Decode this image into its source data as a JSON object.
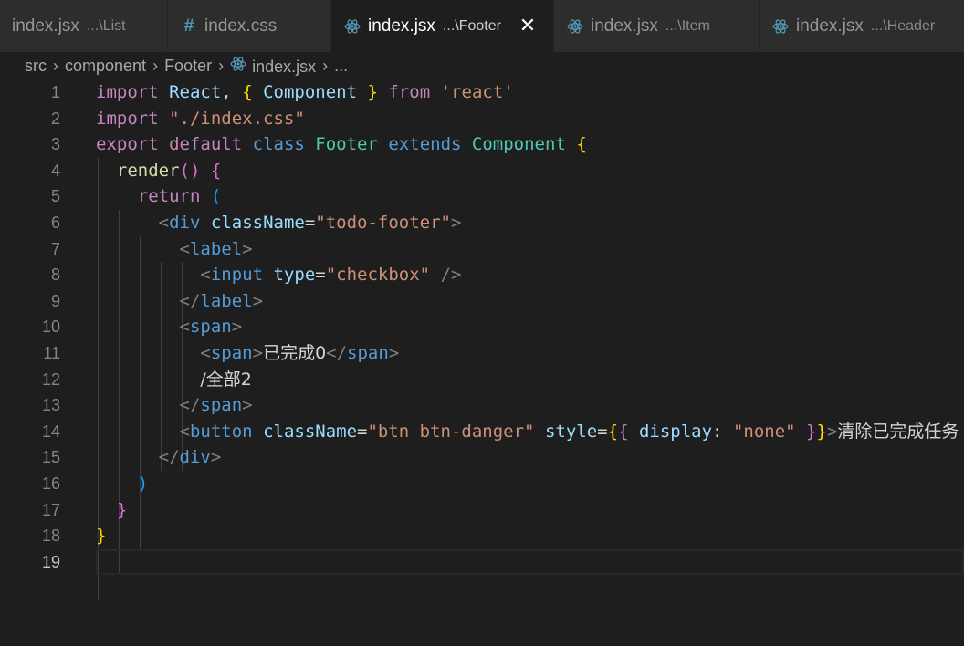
{
  "tabs": [
    {
      "name": "index.jsx",
      "path": "...\\List",
      "icon": "react-icon",
      "active": false
    },
    {
      "name": "index.css",
      "path": "",
      "icon": "hash-icon",
      "active": false
    },
    {
      "name": "index.jsx",
      "path": "...\\Footer",
      "icon": "react-icon",
      "active": true
    },
    {
      "name": "index.jsx",
      "path": "...\\Item",
      "icon": "react-icon",
      "active": false
    },
    {
      "name": "index.jsx",
      "path": "...\\Header",
      "icon": "react-icon",
      "active": false
    }
  ],
  "breadcrumb": {
    "items": [
      "src",
      "component",
      "Footer",
      "index.jsx",
      "..."
    ]
  },
  "editor": {
    "line_numbers": [
      "1",
      "2",
      "3",
      "4",
      "5",
      "6",
      "7",
      "8",
      "9",
      "10",
      "11",
      "12",
      "13",
      "14",
      "15",
      "16",
      "17",
      "18",
      "19"
    ],
    "current_line": 19,
    "lines": [
      [
        [
          "kw",
          "import"
        ],
        [
          "pl",
          " "
        ],
        [
          "vr",
          "React"
        ],
        [
          "pl",
          ", "
        ],
        [
          "b1",
          "{"
        ],
        [
          "pl",
          " "
        ],
        [
          "vr",
          "Component"
        ],
        [
          "pl",
          " "
        ],
        [
          "b1",
          "}"
        ],
        [
          "pl",
          " "
        ],
        [
          "kw",
          "from"
        ],
        [
          "pl",
          " "
        ],
        [
          "str",
          "'react'"
        ]
      ],
      [
        [
          "kw",
          "import"
        ],
        [
          "pl",
          " "
        ],
        [
          "str",
          "\"./index.css\""
        ]
      ],
      [
        [
          "kw",
          "export"
        ],
        [
          "pl",
          " "
        ],
        [
          "kw",
          "default"
        ],
        [
          "pl",
          " "
        ],
        [
          "st",
          "class"
        ],
        [
          "pl",
          " "
        ],
        [
          "ty",
          "Footer"
        ],
        [
          "pl",
          " "
        ],
        [
          "st",
          "extends"
        ],
        [
          "pl",
          " "
        ],
        [
          "ty",
          "Component"
        ],
        [
          "pl",
          " "
        ],
        [
          "b1",
          "{"
        ]
      ],
      [
        [
          "pl",
          "  "
        ],
        [
          "fn",
          "render"
        ],
        [
          "b2",
          "()"
        ],
        [
          "pl",
          " "
        ],
        [
          "b2",
          "{"
        ]
      ],
      [
        [
          "pl",
          "    "
        ],
        [
          "kw",
          "return"
        ],
        [
          "pl",
          " "
        ],
        [
          "b3",
          "("
        ]
      ],
      [
        [
          "pl",
          "      "
        ],
        [
          "br",
          "<"
        ],
        [
          "tg",
          "div"
        ],
        [
          "pl",
          " "
        ],
        [
          "vr",
          "className"
        ],
        [
          "pl",
          "="
        ],
        [
          "str",
          "\"todo-footer\""
        ],
        [
          "br",
          ">"
        ]
      ],
      [
        [
          "pl",
          "        "
        ],
        [
          "br",
          "<"
        ],
        [
          "tg",
          "label"
        ],
        [
          "br",
          ">"
        ]
      ],
      [
        [
          "pl",
          "          "
        ],
        [
          "br",
          "<"
        ],
        [
          "tg",
          "input"
        ],
        [
          "pl",
          " "
        ],
        [
          "vr",
          "type"
        ],
        [
          "pl",
          "="
        ],
        [
          "str",
          "\"checkbox\""
        ],
        [
          "pl",
          " "
        ],
        [
          "br",
          "/>"
        ]
      ],
      [
        [
          "pl",
          "        "
        ],
        [
          "br",
          "</"
        ],
        [
          "tg",
          "label"
        ],
        [
          "br",
          ">"
        ]
      ],
      [
        [
          "pl",
          "        "
        ],
        [
          "br",
          "<"
        ],
        [
          "tg",
          "span"
        ],
        [
          "br",
          ">"
        ]
      ],
      [
        [
          "pl",
          "          "
        ],
        [
          "br",
          "<"
        ],
        [
          "tg",
          "span"
        ],
        [
          "br",
          ">"
        ],
        [
          "zh",
          "已完成0"
        ],
        [
          "br",
          "</"
        ],
        [
          "tg",
          "span"
        ],
        [
          "br",
          ">"
        ]
      ],
      [
        [
          "pl",
          "          "
        ],
        [
          "zh",
          "/全部2"
        ]
      ],
      [
        [
          "pl",
          "        "
        ],
        [
          "br",
          "</"
        ],
        [
          "tg",
          "span"
        ],
        [
          "br",
          ">"
        ]
      ],
      [
        [
          "pl",
          "        "
        ],
        [
          "br",
          "<"
        ],
        [
          "tg",
          "button"
        ],
        [
          "pl",
          " "
        ],
        [
          "vr",
          "className"
        ],
        [
          "pl",
          "="
        ],
        [
          "str",
          "\"btn btn-danger\""
        ],
        [
          "pl",
          " "
        ],
        [
          "vr",
          "style"
        ],
        [
          "pl",
          "="
        ],
        [
          "b1",
          "{"
        ],
        [
          "b2",
          "{"
        ],
        [
          "pl",
          " "
        ],
        [
          "vr",
          "display"
        ],
        [
          "pl",
          ": "
        ],
        [
          "str",
          "\"none\""
        ],
        [
          "pl",
          " "
        ],
        [
          "b2",
          "}"
        ],
        [
          "b1",
          "}"
        ],
        [
          "br",
          ">"
        ],
        [
          "zh",
          "清除已完成任务"
        ]
      ],
      [
        [
          "pl",
          "      "
        ],
        [
          "br",
          "</"
        ],
        [
          "tg",
          "div"
        ],
        [
          "br",
          ">"
        ]
      ],
      [
        [
          "pl",
          "    "
        ],
        [
          "b3",
          ")"
        ]
      ],
      [
        [
          "pl",
          "  "
        ],
        [
          "b2",
          "}"
        ]
      ],
      [
        [
          "b1",
          "}"
        ]
      ],
      [
        [
          "pl",
          ""
        ]
      ]
    ]
  }
}
